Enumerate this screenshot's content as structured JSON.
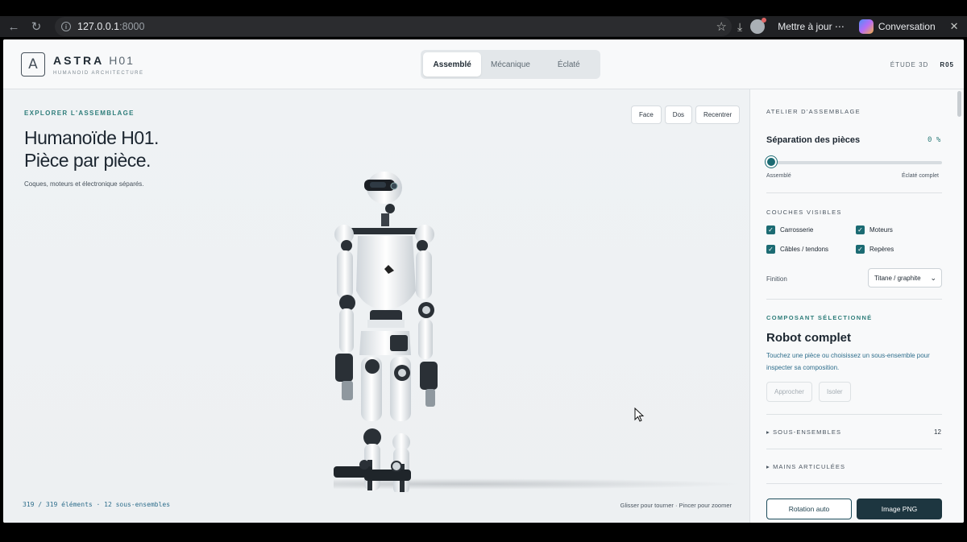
{
  "browser": {
    "url_host": "127.0.0.1",
    "url_port": ":8000",
    "update_label": "Mettre à jour",
    "conversation_label": "Conversation"
  },
  "header": {
    "logo_letter": "A",
    "brand": "ASTRA",
    "model": "H01",
    "subtitle": "HUMANOID ARCHITECTURE",
    "tabs": [
      {
        "label": "Assemblé",
        "active": true
      },
      {
        "label": "Mécanique",
        "active": false
      },
      {
        "label": "Éclaté",
        "active": false
      }
    ],
    "right_label": "ÉTUDE 3D",
    "right_badge": "R05"
  },
  "viewport": {
    "eyebrow": "EXPLORER L'ASSEMBLAGE",
    "title_line1": "Humanoïde H01.",
    "title_line2": "Pièce par pièce.",
    "subtitle": "Coques, moteurs et électronique séparés.",
    "view_buttons": [
      "Face",
      "Dos",
      "Recentrer"
    ],
    "counter": "319 / 319 éléments · 12 sous-ensembles",
    "hint": "Glisser pour tourner · Pincer pour zoomer"
  },
  "panel": {
    "eyebrow": "ATELIER D'ASSEMBLAGE",
    "separation": {
      "label": "Séparation des pièces",
      "value": "0 %",
      "fraction": 0,
      "min_label": "Assemblé",
      "max_label": "Éclaté complet"
    },
    "layers": {
      "title": "COUCHES VISIBLES",
      "items": [
        {
          "label": "Carrosserie",
          "checked": true
        },
        {
          "label": "Moteurs",
          "checked": true
        },
        {
          "label": "Câbles / tendons",
          "checked": true
        },
        {
          "label": "Repères",
          "checked": true
        }
      ],
      "finish_label": "Finition",
      "finish_value": "Titane / graphite"
    },
    "component": {
      "eyebrow": "COMPOSANT SÉLECTIONNÉ",
      "title": "Robot complet",
      "description": "Touchez une pièce ou choisissez un sous-ensemble pour inspecter sa composition.",
      "approach_label": "Approcher",
      "isolate_label": "Isoler"
    },
    "subassemblies": {
      "label": "SOUS-ENSEMBLES",
      "count": "12"
    },
    "hands": {
      "label": "MAINS ARTICULÉES"
    },
    "actions": {
      "rotate_label": "Rotation auto",
      "png_label": "Image PNG"
    }
  },
  "colors": {
    "accent": "#1c6b73",
    "dark_button": "#1d3640",
    "eyebrow_teal": "#2e7d7a"
  }
}
